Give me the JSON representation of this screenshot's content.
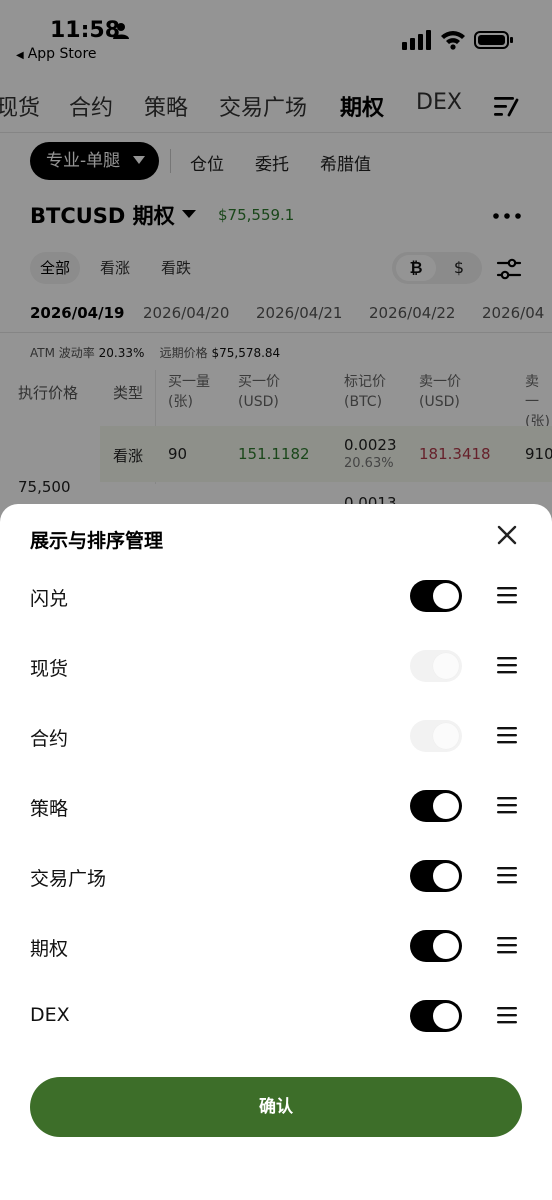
{
  "status": {
    "time": "11:58",
    "back_label": "App Store"
  },
  "top_tabs": [
    "现货",
    "合约",
    "策略",
    "交易广场",
    "期权",
    "DEX"
  ],
  "top_tabs_active": "期权",
  "mode_selector": "专业-单腿",
  "sub_links": [
    "仓位",
    "委托",
    "希腊值"
  ],
  "pair": {
    "title": "BTCUSD 期权",
    "price": "$75,559.1"
  },
  "filters": [
    "全部",
    "看涨",
    "看跌"
  ],
  "currency": {
    "btc_symbol": "₿",
    "usd_symbol": "$"
  },
  "dates": [
    "2026/04/19",
    "2026/04/20",
    "2026/04/21",
    "2026/04/22",
    "2026/04"
  ],
  "atm": {
    "vol_label": "ATM 波动率",
    "vol_value": "20.33%",
    "fwd_label": "远期价格",
    "fwd_value": "$75,578.84"
  },
  "table": {
    "col_strike": "执行价格",
    "col_type": "类型",
    "headers": [
      {
        "l1": "买一量",
        "l2": "(张)"
      },
      {
        "l1": "买一价",
        "l2": "(USD)"
      },
      {
        "l1": "标记价",
        "l2": "(BTC)"
      },
      {
        "l1": "卖一价",
        "l2": "(USD)"
      },
      {
        "l1": "卖一",
        "l2": "(张)"
      }
    ],
    "strike": "75,500",
    "row": {
      "type": "看涨",
      "bid_qty": "90",
      "bid_price": "151.1182",
      "mark_price": "0.0023",
      "mark_iv": "20.63%",
      "ask_price": "181.3418",
      "ask_qty": "910"
    },
    "next_mark": "0.0013"
  },
  "sheet": {
    "title": "展示与排序管理",
    "items": [
      {
        "label": "闪兑",
        "enabled": true,
        "locked": false
      },
      {
        "label": "现货",
        "enabled": true,
        "locked": true
      },
      {
        "label": "合约",
        "enabled": true,
        "locked": true
      },
      {
        "label": "策略",
        "enabled": true,
        "locked": false
      },
      {
        "label": "交易广场",
        "enabled": true,
        "locked": false
      },
      {
        "label": "期权",
        "enabled": true,
        "locked": false
      },
      {
        "label": "DEX",
        "enabled": true,
        "locked": false
      }
    ],
    "confirm_label": "确认"
  },
  "colors": {
    "accent_green": "#3d6e29",
    "price_green": "#2e7a2e",
    "ask_red": "#b03a4a"
  }
}
